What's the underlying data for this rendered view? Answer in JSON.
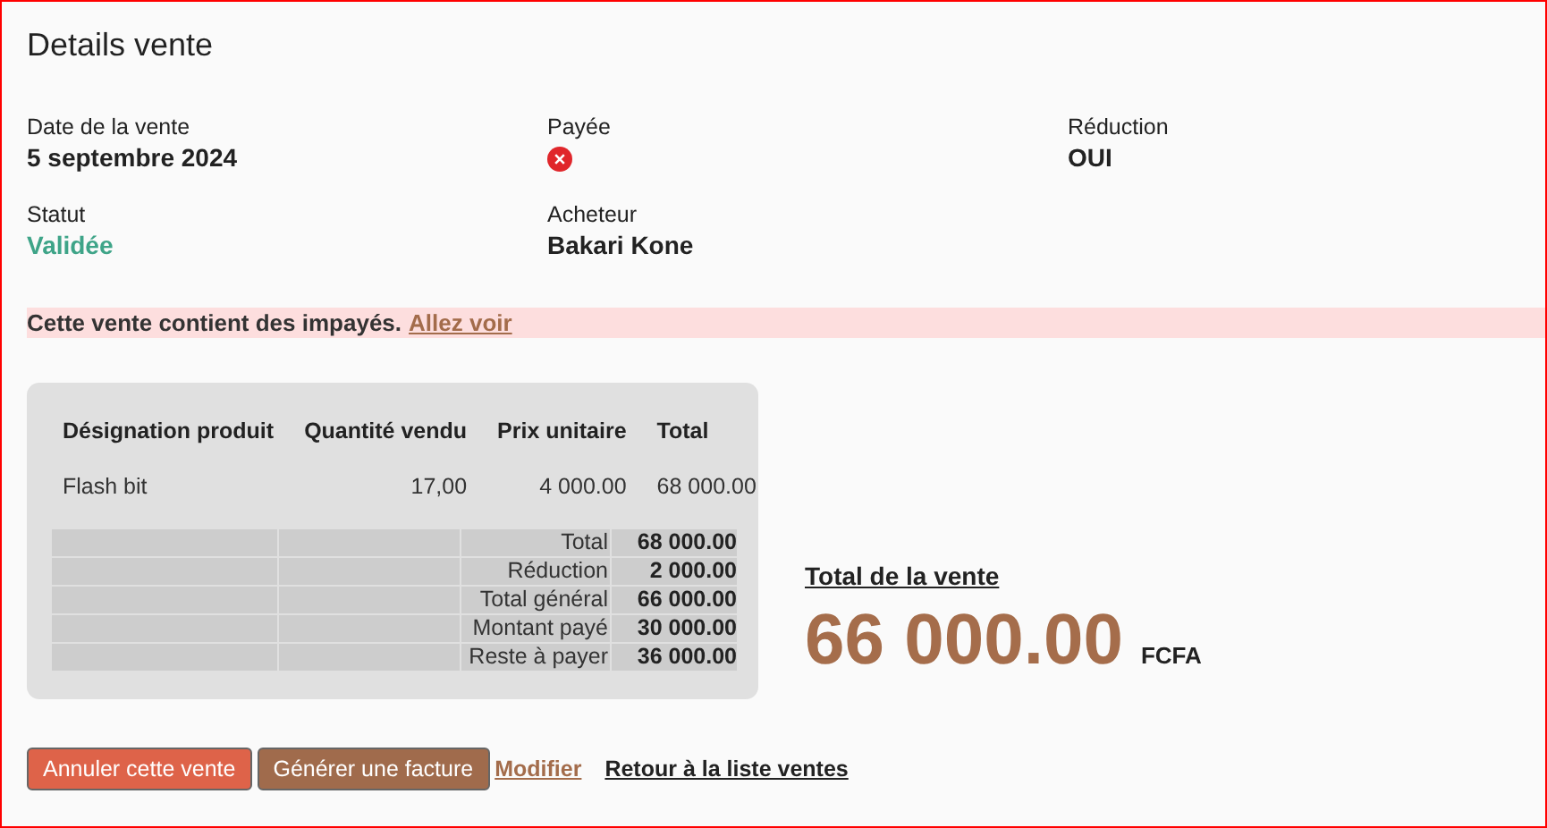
{
  "title": "Details vente",
  "fields": [
    {
      "label": "Date de la vente",
      "kind": "text",
      "value": "5 septembre 2024"
    },
    {
      "label": "Payée",
      "kind": "flag",
      "on": false
    },
    {
      "label": "Réduction",
      "kind": "text",
      "value": "OUI"
    },
    {
      "label": "Statut",
      "kind": "status",
      "value": "Validée"
    },
    {
      "label": "Acheteur",
      "kind": "text",
      "value": "Bakari Kone"
    }
  ],
  "alert": {
    "text": "Cette vente contient des impayés.",
    "link": "Allez voir"
  },
  "table": {
    "columns": [
      "Désignation produit",
      "Quantité vendu",
      "Prix unitaire",
      "Total"
    ],
    "rows": [
      [
        "Flash bit",
        "17,00",
        "4 000.00",
        "68 000.00"
      ]
    ],
    "summary": [
      {
        "label": "Total",
        "value": "68 000.00"
      },
      {
        "label": "Réduction",
        "value": "2 000.00"
      },
      {
        "label": "Total général",
        "value": "66 000.00"
      },
      {
        "label": "Montant payé",
        "value": "30 000.00"
      },
      {
        "label": "Reste à payer",
        "value": "36 000.00"
      }
    ]
  },
  "total": {
    "label": "Total de la vente",
    "amount": "66 000.00",
    "currency": "FCFA"
  },
  "actions": [
    {
      "label": "Annuler cette vente",
      "kind": "danger"
    },
    {
      "label": "Générer une facture",
      "kind": "primary"
    },
    {
      "label": "Modifier",
      "kind": "link"
    },
    {
      "label": "Retour à la liste ventes",
      "kind": "link-dark"
    }
  ]
}
